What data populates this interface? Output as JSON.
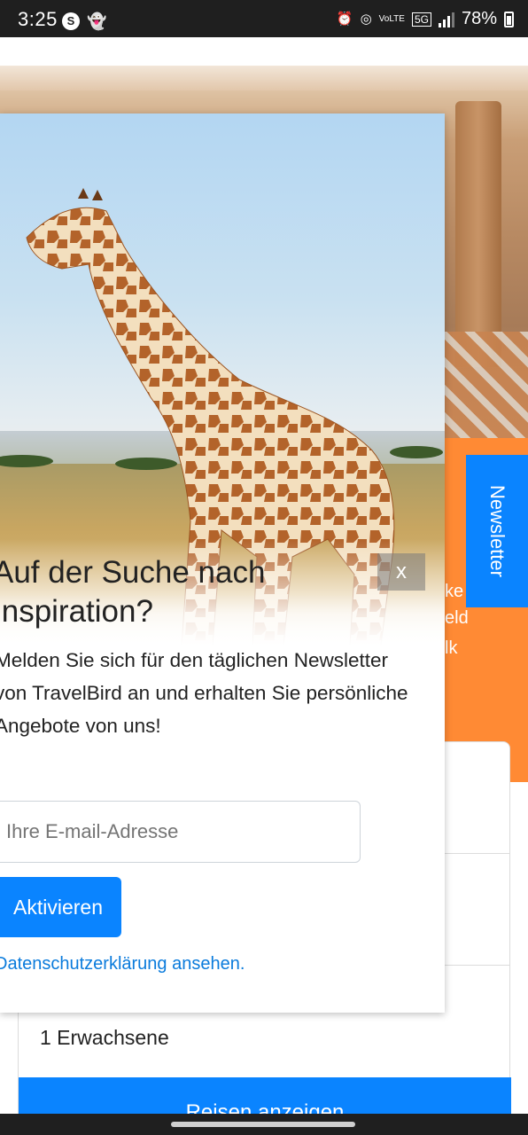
{
  "status_bar": {
    "time": "3:25",
    "battery": "78%",
    "network": "5G",
    "volte": "VoLTE"
  },
  "background": {
    "newsletter_tab_label": "Newsletter",
    "band_text_lines": [
      "ke",
      "eld",
      "lk"
    ],
    "search_guests": "1 Erwachsene",
    "search_button": "Reisen anzeigen"
  },
  "modal": {
    "title": "Auf der Suche nach Inspiration?",
    "body": "Melden Sie sich für den täglichen Newsletter von TravelBird an und erhalten Sie persönliche Angebote von uns!",
    "email_placeholder": "Ihre E-mail-Adresse",
    "activate_button": "Aktivieren",
    "privacy_link": "Datenschutzerklärung ansehen.",
    "close_label": "x"
  },
  "colors": {
    "accent_blue": "#0a84ff",
    "orange": "#ff8a34",
    "link_blue": "#0a7bdc"
  }
}
